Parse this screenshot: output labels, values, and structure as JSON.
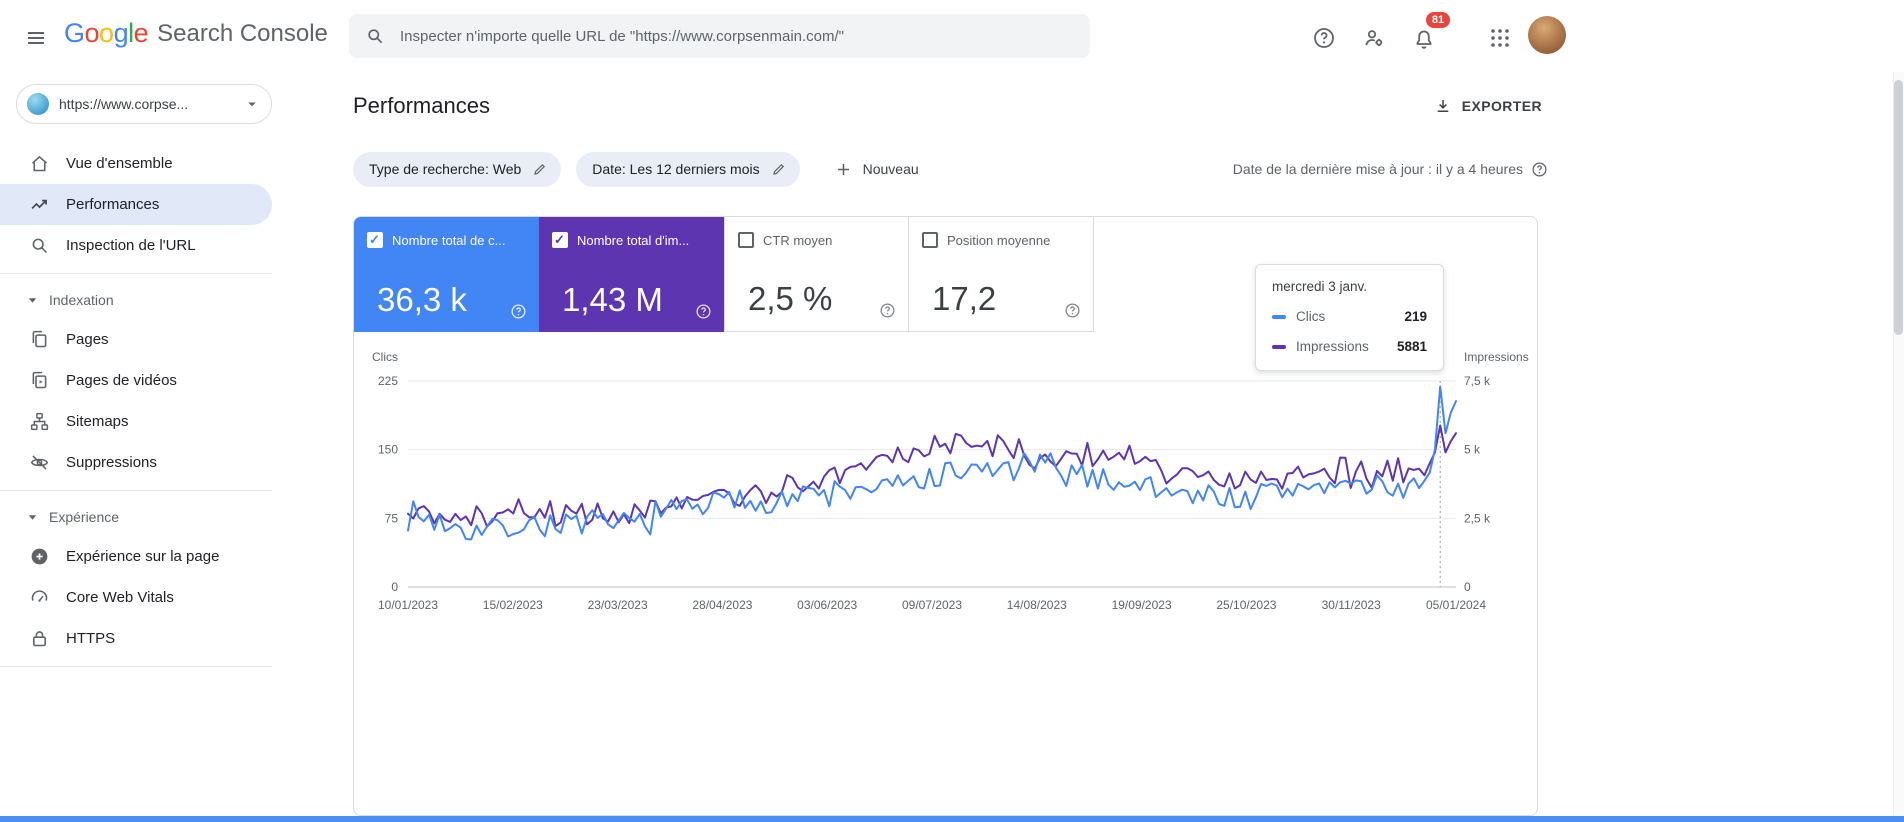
{
  "colors": {
    "accent_blue": "#4285f4",
    "accent_purple": "#5e35b1",
    "badge_red": "#e8453c",
    "footer_strip": "#4c8df6"
  },
  "topbar": {
    "logo": {
      "letters": [
        {
          "ch": "G",
          "color": "#4285F4"
        },
        {
          "ch": "o",
          "color": "#EA4335"
        },
        {
          "ch": "o",
          "color": "#FBBC05"
        },
        {
          "ch": "g",
          "color": "#4285F4"
        },
        {
          "ch": "l",
          "color": "#34A853"
        },
        {
          "ch": "e",
          "color": "#EA4335"
        }
      ],
      "suffix": "Search Console"
    },
    "search_placeholder": "Inspecter n'importe quelle URL de \"https://www.corpsenmain.com/\"",
    "notification_count": "81"
  },
  "sidebar": {
    "property_label": "https://www.corpse...",
    "items": [
      {
        "label": "Vue d'ensemble"
      },
      {
        "label": "Performances"
      },
      {
        "label": "Inspection de l'URL"
      }
    ],
    "sections": [
      {
        "title": "Indexation",
        "items": [
          "Pages",
          "Pages de vidéos",
          "Sitemaps",
          "Suppressions"
        ]
      },
      {
        "title": "Expérience",
        "items": [
          "Expérience sur la page",
          "Core Web Vitals",
          "HTTPS"
        ]
      }
    ]
  },
  "main": {
    "title": "Performances",
    "export_label": "EXPORTER",
    "filters": [
      {
        "label": "Type de recherche: Web"
      },
      {
        "label": "Date: Les 12 derniers mois"
      }
    ],
    "new_filter_label": "Nouveau",
    "last_update": "Date de la dernière mise à jour : il y a 4 heures",
    "metrics": [
      {
        "label": "Nombre total de c...",
        "value": "36,3 k",
        "checked": true,
        "accent": "accent_blue"
      },
      {
        "label": "Nombre total d'im...",
        "value": "1,43 M",
        "checked": true,
        "accent": "accent_purple"
      },
      {
        "label": "CTR moyen",
        "value": "2,5 %",
        "checked": false
      },
      {
        "label": "Position moyenne",
        "value": "17,2",
        "checked": false
      }
    ],
    "tooltip": {
      "title": "mercredi 3 janv.",
      "rows": [
        {
          "label": "Clics",
          "value": "219",
          "accent": "accent_blue"
        },
        {
          "label": "Impressions",
          "value": "5881",
          "accent": "accent_purple"
        }
      ]
    }
  },
  "chart_data": {
    "type": "line",
    "x_labels": [
      "10/01/2023",
      "15/02/2023",
      "23/03/2023",
      "28/04/2023",
      "03/06/2023",
      "09/07/2023",
      "14/08/2023",
      "19/09/2023",
      "25/10/2023",
      "30/11/2023",
      "05/01/2024"
    ],
    "axes": {
      "left": {
        "title": "Clics",
        "max": 225,
        "ticks": [
          {
            "v": 0,
            "label": "0"
          },
          {
            "v": 75,
            "label": "75"
          },
          {
            "v": 150,
            "label": "150"
          },
          {
            "v": 225,
            "label": "225"
          }
        ]
      },
      "right": {
        "title": "Impressions",
        "max": 7500,
        "ticks": [
          {
            "v": 0,
            "label": "0"
          },
          {
            "v": 2500,
            "label": "2,5 k"
          },
          {
            "v": 5000,
            "label": "5 k"
          },
          {
            "v": 7500,
            "label": "7,5 k"
          }
        ]
      }
    },
    "hover": {
      "date": "mercredi 3 janv.",
      "clics": 219,
      "impressions": 5881
    },
    "series": [
      {
        "name": "Clics",
        "accent": "accent_blue",
        "axis": "left",
        "seed": 7,
        "noise": 13,
        "anchors": [
          80,
          62,
          70,
          66,
          88,
          95,
          102,
          110,
          125,
          132,
          118,
          104,
          96,
          112,
          108,
          118
        ],
        "tail": [
          125,
          150,
          219,
          168,
          190,
          203
        ]
      },
      {
        "name": "Impressions",
        "accent": "accent_purple",
        "axis": "right",
        "seed": 21,
        "noise": 430,
        "anchors": [
          2750,
          2500,
          2850,
          2600,
          3100,
          3400,
          3900,
          4700,
          5300,
          4900,
          4700,
          4300,
          3900,
          4300,
          4100,
          4500
        ],
        "tail": [
          4500,
          4900,
          5881,
          4900,
          5300,
          5600
        ]
      }
    ]
  }
}
